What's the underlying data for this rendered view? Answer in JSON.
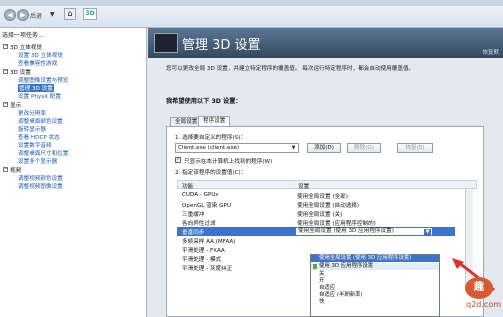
{
  "toolbar": {
    "back": "◀",
    "back_label": "后退",
    "forward": "▶",
    "dropdown": "▼",
    "home_icon": "home-icon",
    "nv_badge": "3D"
  },
  "left": {
    "title": "选择一项任务...",
    "items": [
      {
        "label": "3D 设置",
        "kind": "cat"
      },
      {
        "label": "调整图像设置与预览",
        "kind": "sub"
      },
      {
        "label": "管理 3D 设置",
        "kind": "sel"
      },
      {
        "label": "设置 PhysX 配置",
        "kind": "sub"
      },
      {
        "label": "显示",
        "kind": "cat"
      },
      {
        "label": "更改分辨率",
        "kind": "sub"
      },
      {
        "label": "调整桌面颜色设置",
        "kind": "sub"
      },
      {
        "label": "旋转显示器",
        "kind": "sub"
      },
      {
        "label": "查看 HDCP 状态",
        "kind": "sub"
      },
      {
        "label": "设置数字音频",
        "kind": "sub"
      },
      {
        "label": "调整桌面尺寸和位置",
        "kind": "sub"
      },
      {
        "label": "设置多个显示器",
        "kind": "sub"
      },
      {
        "label": "视频",
        "kind": "cat"
      },
      {
        "label": "调整视频颜色设置",
        "kind": "sub"
      },
      {
        "label": "调整视频图像设置",
        "kind": "sub"
      }
    ],
    "top_items": [
      {
        "label": "3D 立体视觉",
        "kind": "cat"
      },
      {
        "label": "设置 3D 立体视觉",
        "kind": "sub"
      },
      {
        "label": "查看兼容性游戏",
        "kind": "sub"
      }
    ]
  },
  "right": {
    "title": "管理 3D 设置",
    "restore": "恢复默",
    "description": "您可以更改全局 3D 设置，并建立特定程序的覆盖值。 每次运行特定程序时，都会自动使用覆盖值。",
    "want": "我希望使用以下 3D 设置：",
    "tabs": [
      "全局设置",
      "程序设置"
    ],
    "step1": "1. 选择要自定义的程序(S)：",
    "program": "Client.exe (client.exe)",
    "add": "添加(D)",
    "remove": "删除(O)",
    "restore_btn": "恢复(E)",
    "only_show": "只显示在本计算机上找到的程序(W)",
    "step2": "2. 指定该程序的设置值(C)：",
    "col_feature": "功能",
    "col_setting": "设置",
    "rows": [
      {
        "feature": "CUDA - GPUs",
        "setting": "使用全局设置 (全部)"
      },
      {
        "feature": "OpenGL 渲染 GPU",
        "setting": "使用全局设置 (自动选择)"
      },
      {
        "feature": "三重缓冲",
        "setting": "使用全局设置 (关)"
      },
      {
        "feature": "各向异性过滤",
        "setting": "使用全局设置 (应用程序控制的)"
      },
      {
        "feature": "垂直同步",
        "setting": "使用全局设置 (使用 3D 应用程序设置)"
      },
      {
        "feature": "多帧采样 AA (MFAA)",
        "setting": ""
      },
      {
        "feature": "平滑处理 - FXAA",
        "setting": ""
      },
      {
        "feature": "平滑处理 - 模式",
        "setting": ""
      },
      {
        "feature": "平滑处理 - 灰度纠正",
        "setting": ""
      }
    ],
    "menu": [
      {
        "label": "使用全局设置 (使用 3D 应用程序设置)",
        "state": "hl"
      },
      {
        "label": "使用 3D 应用程序设置",
        "state": "cur"
      },
      {
        "label": "关",
        "state": ""
      },
      {
        "label": "开",
        "state": ""
      },
      {
        "label": "自适应",
        "state": ""
      },
      {
        "label": "自适应 (半刷新率)",
        "state": ""
      },
      {
        "label": "快",
        "state": ""
      }
    ]
  },
  "watermark": {
    "logo": "趣",
    "text": "q2d.com"
  }
}
